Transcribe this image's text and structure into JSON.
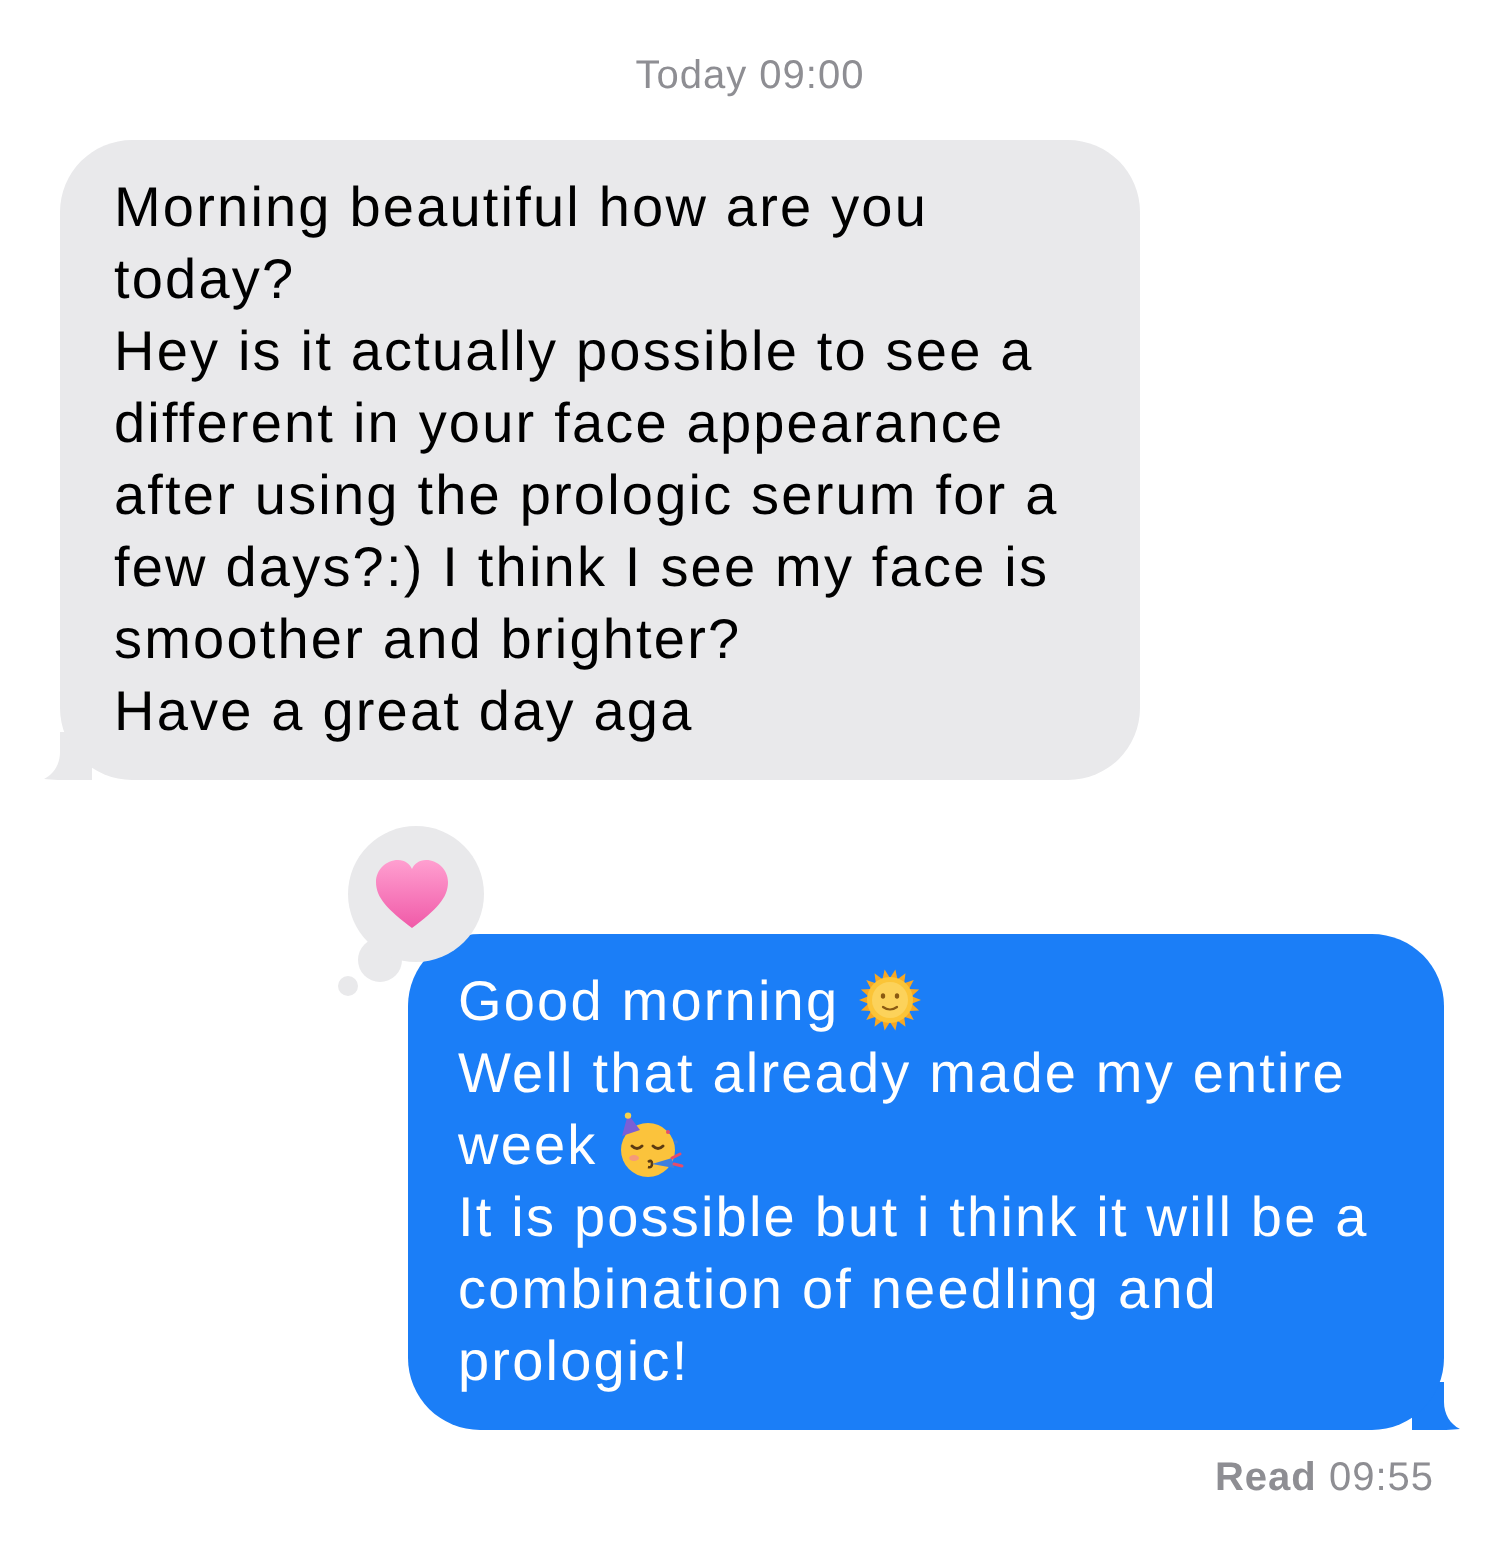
{
  "timestamp": "Today 09:00",
  "messages": [
    {
      "kind": "incoming",
      "paragraphs": [
        {
          "kind": "plain",
          "text": "Morning beautiful how are you today?"
        },
        {
          "kind": "plain",
          "text": "Hey is it actually possible to see a different in your face appearance after using the prologic serum for a few days?:) I think I see my face is smoother and brighter?"
        },
        {
          "kind": "plain",
          "text": "Have a great day aga"
        }
      ]
    },
    {
      "kind": "outgoing",
      "reaction": {
        "kind": "heart"
      },
      "paragraphs": [
        {
          "kind": "sun",
          "text": "Good morning"
        },
        {
          "kind": "plain",
          "text": "Well that already made my entire"
        },
        {
          "kind": "party",
          "text": "week"
        },
        {
          "kind": "plain",
          "text": "It is possible but i think it will be a combination of needling and prologic!"
        }
      ]
    }
  ],
  "receipt": "**Read** 09:55"
}
